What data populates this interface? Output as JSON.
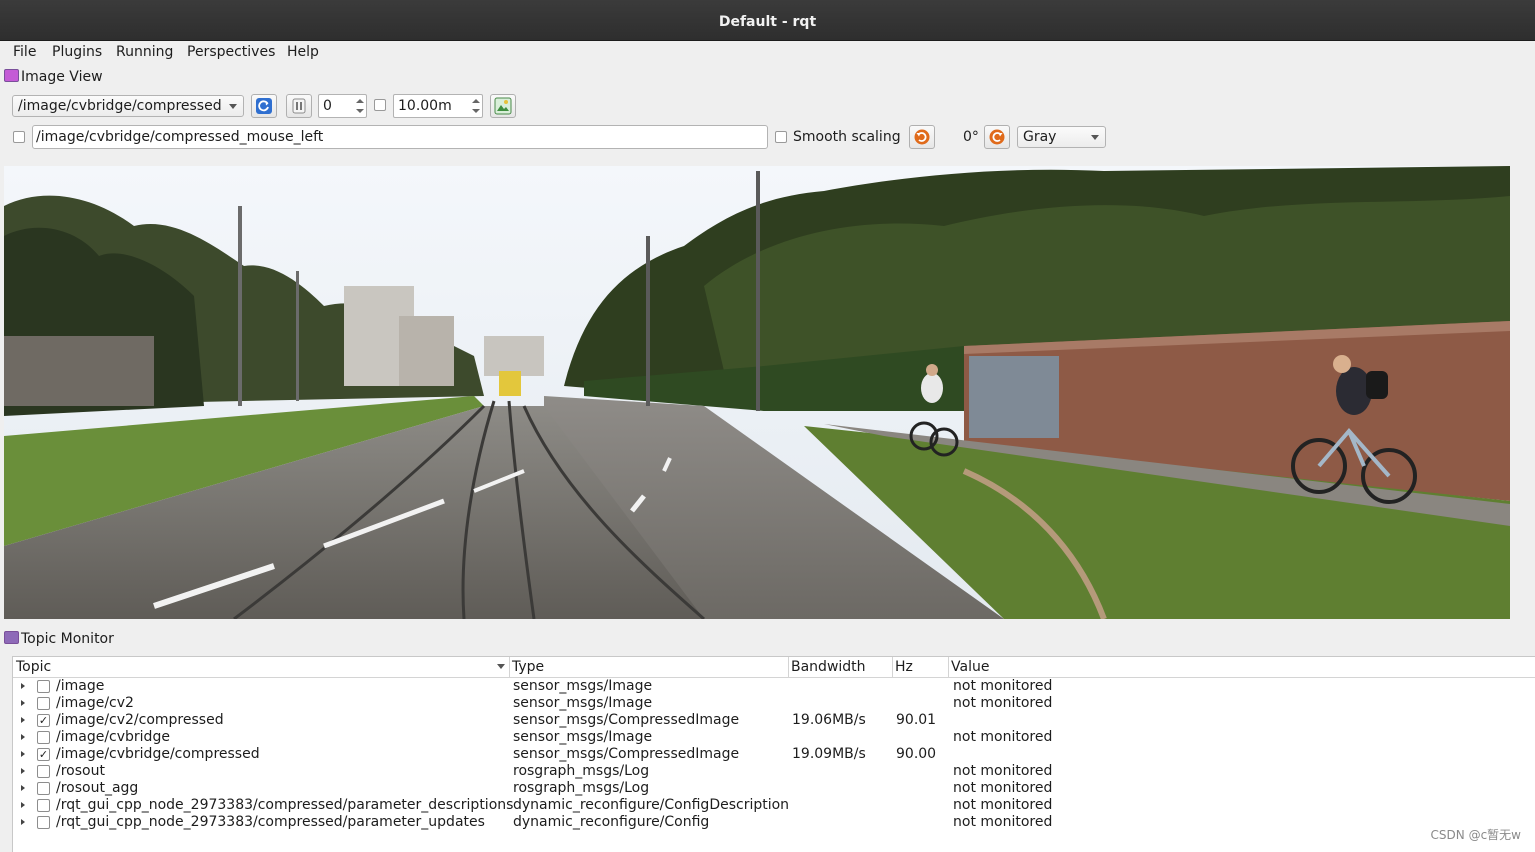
{
  "window": {
    "title": "Default - rqt"
  },
  "menu": [
    "File",
    "Plugins",
    "Running",
    "Perspectives",
    "Help"
  ],
  "image_view": {
    "panel_title": "Image View",
    "topic": "/image/cvbridge/compressed",
    "spin_value": "0",
    "distance_value": "10.00m",
    "mouse_topic": "/image/cvbridge/compressed_mouse_left",
    "smooth_scaling_label": "Smooth scaling",
    "rotation_label": "0°",
    "color_scheme": "Gray"
  },
  "topic_monitor": {
    "panel_title": "Topic Monitor",
    "columns": [
      "Topic",
      "Type",
      "Bandwidth",
      "Hz",
      "Value"
    ],
    "rows": [
      {
        "topic": "/image",
        "type": "sensor_msgs/Image",
        "bandwidth": "",
        "hz": "",
        "value": "not monitored",
        "checked": false,
        "mark": ""
      },
      {
        "topic": "/image/cv2",
        "type": "sensor_msgs/Image",
        "bandwidth": "",
        "hz": "",
        "value": "not monitored",
        "checked": false,
        "mark": ""
      },
      {
        "topic": "/image/cv2/compressed",
        "type": "sensor_msgs/CompressedImage",
        "bandwidth": "19.06MB/s",
        "hz": "90.01",
        "value": "",
        "checked": true,
        "mark": "✓"
      },
      {
        "topic": "/image/cvbridge",
        "type": "sensor_msgs/Image",
        "bandwidth": "",
        "hz": "",
        "value": "not monitored",
        "checked": false,
        "mark": ""
      },
      {
        "topic": "/image/cvbridge/compressed",
        "type": "sensor_msgs/CompressedImage",
        "bandwidth": "19.09MB/s",
        "hz": "90.00",
        "value": "",
        "checked": true,
        "mark": "✓"
      },
      {
        "topic": "/rosout",
        "type": "rosgraph_msgs/Log",
        "bandwidth": "",
        "hz": "",
        "value": "not monitored",
        "checked": false,
        "mark": ""
      },
      {
        "topic": "/rosout_agg",
        "type": "rosgraph_msgs/Log",
        "bandwidth": "",
        "hz": "",
        "value": "not monitored",
        "checked": false,
        "mark": ""
      },
      {
        "topic": "/rqt_gui_cpp_node_2973383/compressed/parameter_descriptions",
        "type": "dynamic_reconfigure/ConfigDescription",
        "bandwidth": "",
        "hz": "",
        "value": "not monitored",
        "checked": false,
        "mark": ""
      },
      {
        "topic": "/rqt_gui_cpp_node_2973383/compressed/parameter_updates",
        "type": "dynamic_reconfigure/Config",
        "bandwidth": "",
        "hz": "",
        "value": "not monitored",
        "checked": false,
        "mark": ""
      }
    ]
  },
  "watermark": "CSDN @c暂无w",
  "colors": {
    "titlebar": "#2e2e2e",
    "background": "#efefef",
    "accent_icon": "#7a4f9a",
    "refresh_blue": "#2f6fd0",
    "rotate_orange": "#e06a1a"
  },
  "icons": [
    "refresh-icon",
    "pause-icon",
    "save-image-icon",
    "rotate-left-icon",
    "rotate-right-icon",
    "dropdown-arrow-icon",
    "expand-arrow-icon"
  ]
}
